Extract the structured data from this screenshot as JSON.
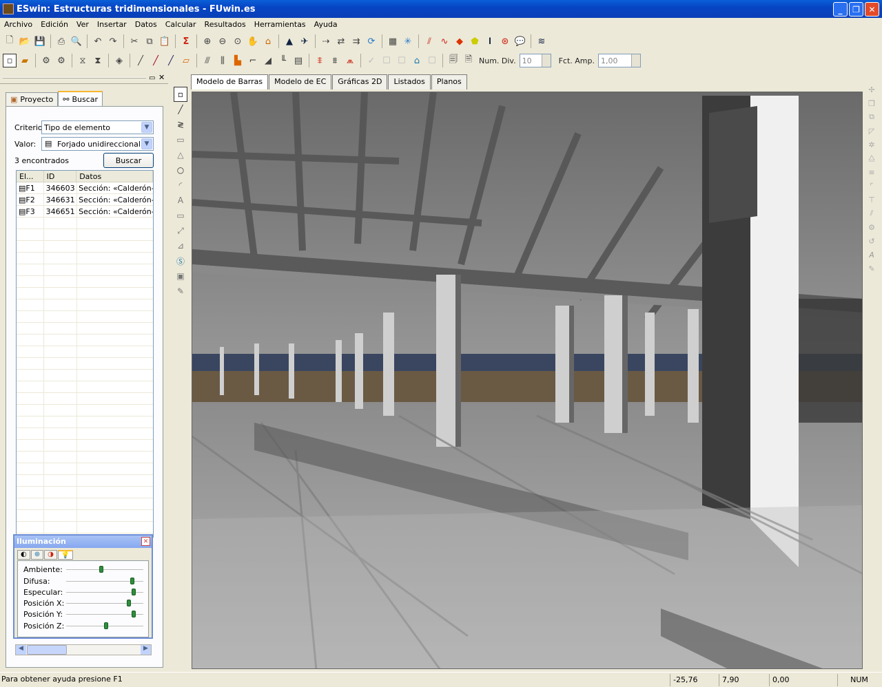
{
  "window": {
    "title": "ESwin: Estructuras tridimensionales - FUwin.es"
  },
  "menu": [
    "Archivo",
    "Edición",
    "Ver",
    "Insertar",
    "Datos",
    "Calcular",
    "Resultados",
    "Herramientas",
    "Ayuda"
  ],
  "toolbar": {
    "num_div_label": "Num. Div.",
    "num_div_value": "10",
    "fct_amp_label": "Fct. Amp.",
    "fct_amp_value": "1,00"
  },
  "leftpanel": {
    "tabs": [
      {
        "label": "Proyecto"
      },
      {
        "label": "Buscar"
      }
    ],
    "criterio_label": "Criterio:",
    "criterio_value": "Tipo de elemento",
    "valor_label": "Valor:",
    "valor_value": "Forjado unidireccional",
    "found_text": "3 encontrados",
    "search_button": "Buscar",
    "columns": [
      "El...",
      "ID",
      "Datos"
    ],
    "rows": [
      {
        "el": "F1",
        "id": "346603",
        "datos": "Sección: «Calderón-T..."
      },
      {
        "el": "F2",
        "id": "346631",
        "datos": "Sección: «Calderón-T..."
      },
      {
        "el": "F3",
        "id": "346651",
        "datos": "Sección: «Calderón-T..."
      }
    ]
  },
  "illumination": {
    "title": "Iluminación",
    "sliders": [
      {
        "label": "Ambiente:",
        "value": 0.45
      },
      {
        "label": "Difusa:",
        "value": 0.88
      },
      {
        "label": "Especular:",
        "value": 0.9
      },
      {
        "label": "Posición X:",
        "value": 0.83
      },
      {
        "label": "Posición Y:",
        "value": 0.9
      },
      {
        "label": "Posición Z:",
        "value": 0.52
      }
    ]
  },
  "doctabs": [
    {
      "label": "Modelo de Barras"
    },
    {
      "label": "Modelo de EC"
    },
    {
      "label": "Gráficas 2D"
    },
    {
      "label": "Listados"
    },
    {
      "label": "Planos"
    }
  ],
  "statusbar": {
    "help": "Para obtener ayuda presione F1",
    "x": "-25,76",
    "y": "7,90",
    "z": "0,00",
    "num": "NUM"
  }
}
